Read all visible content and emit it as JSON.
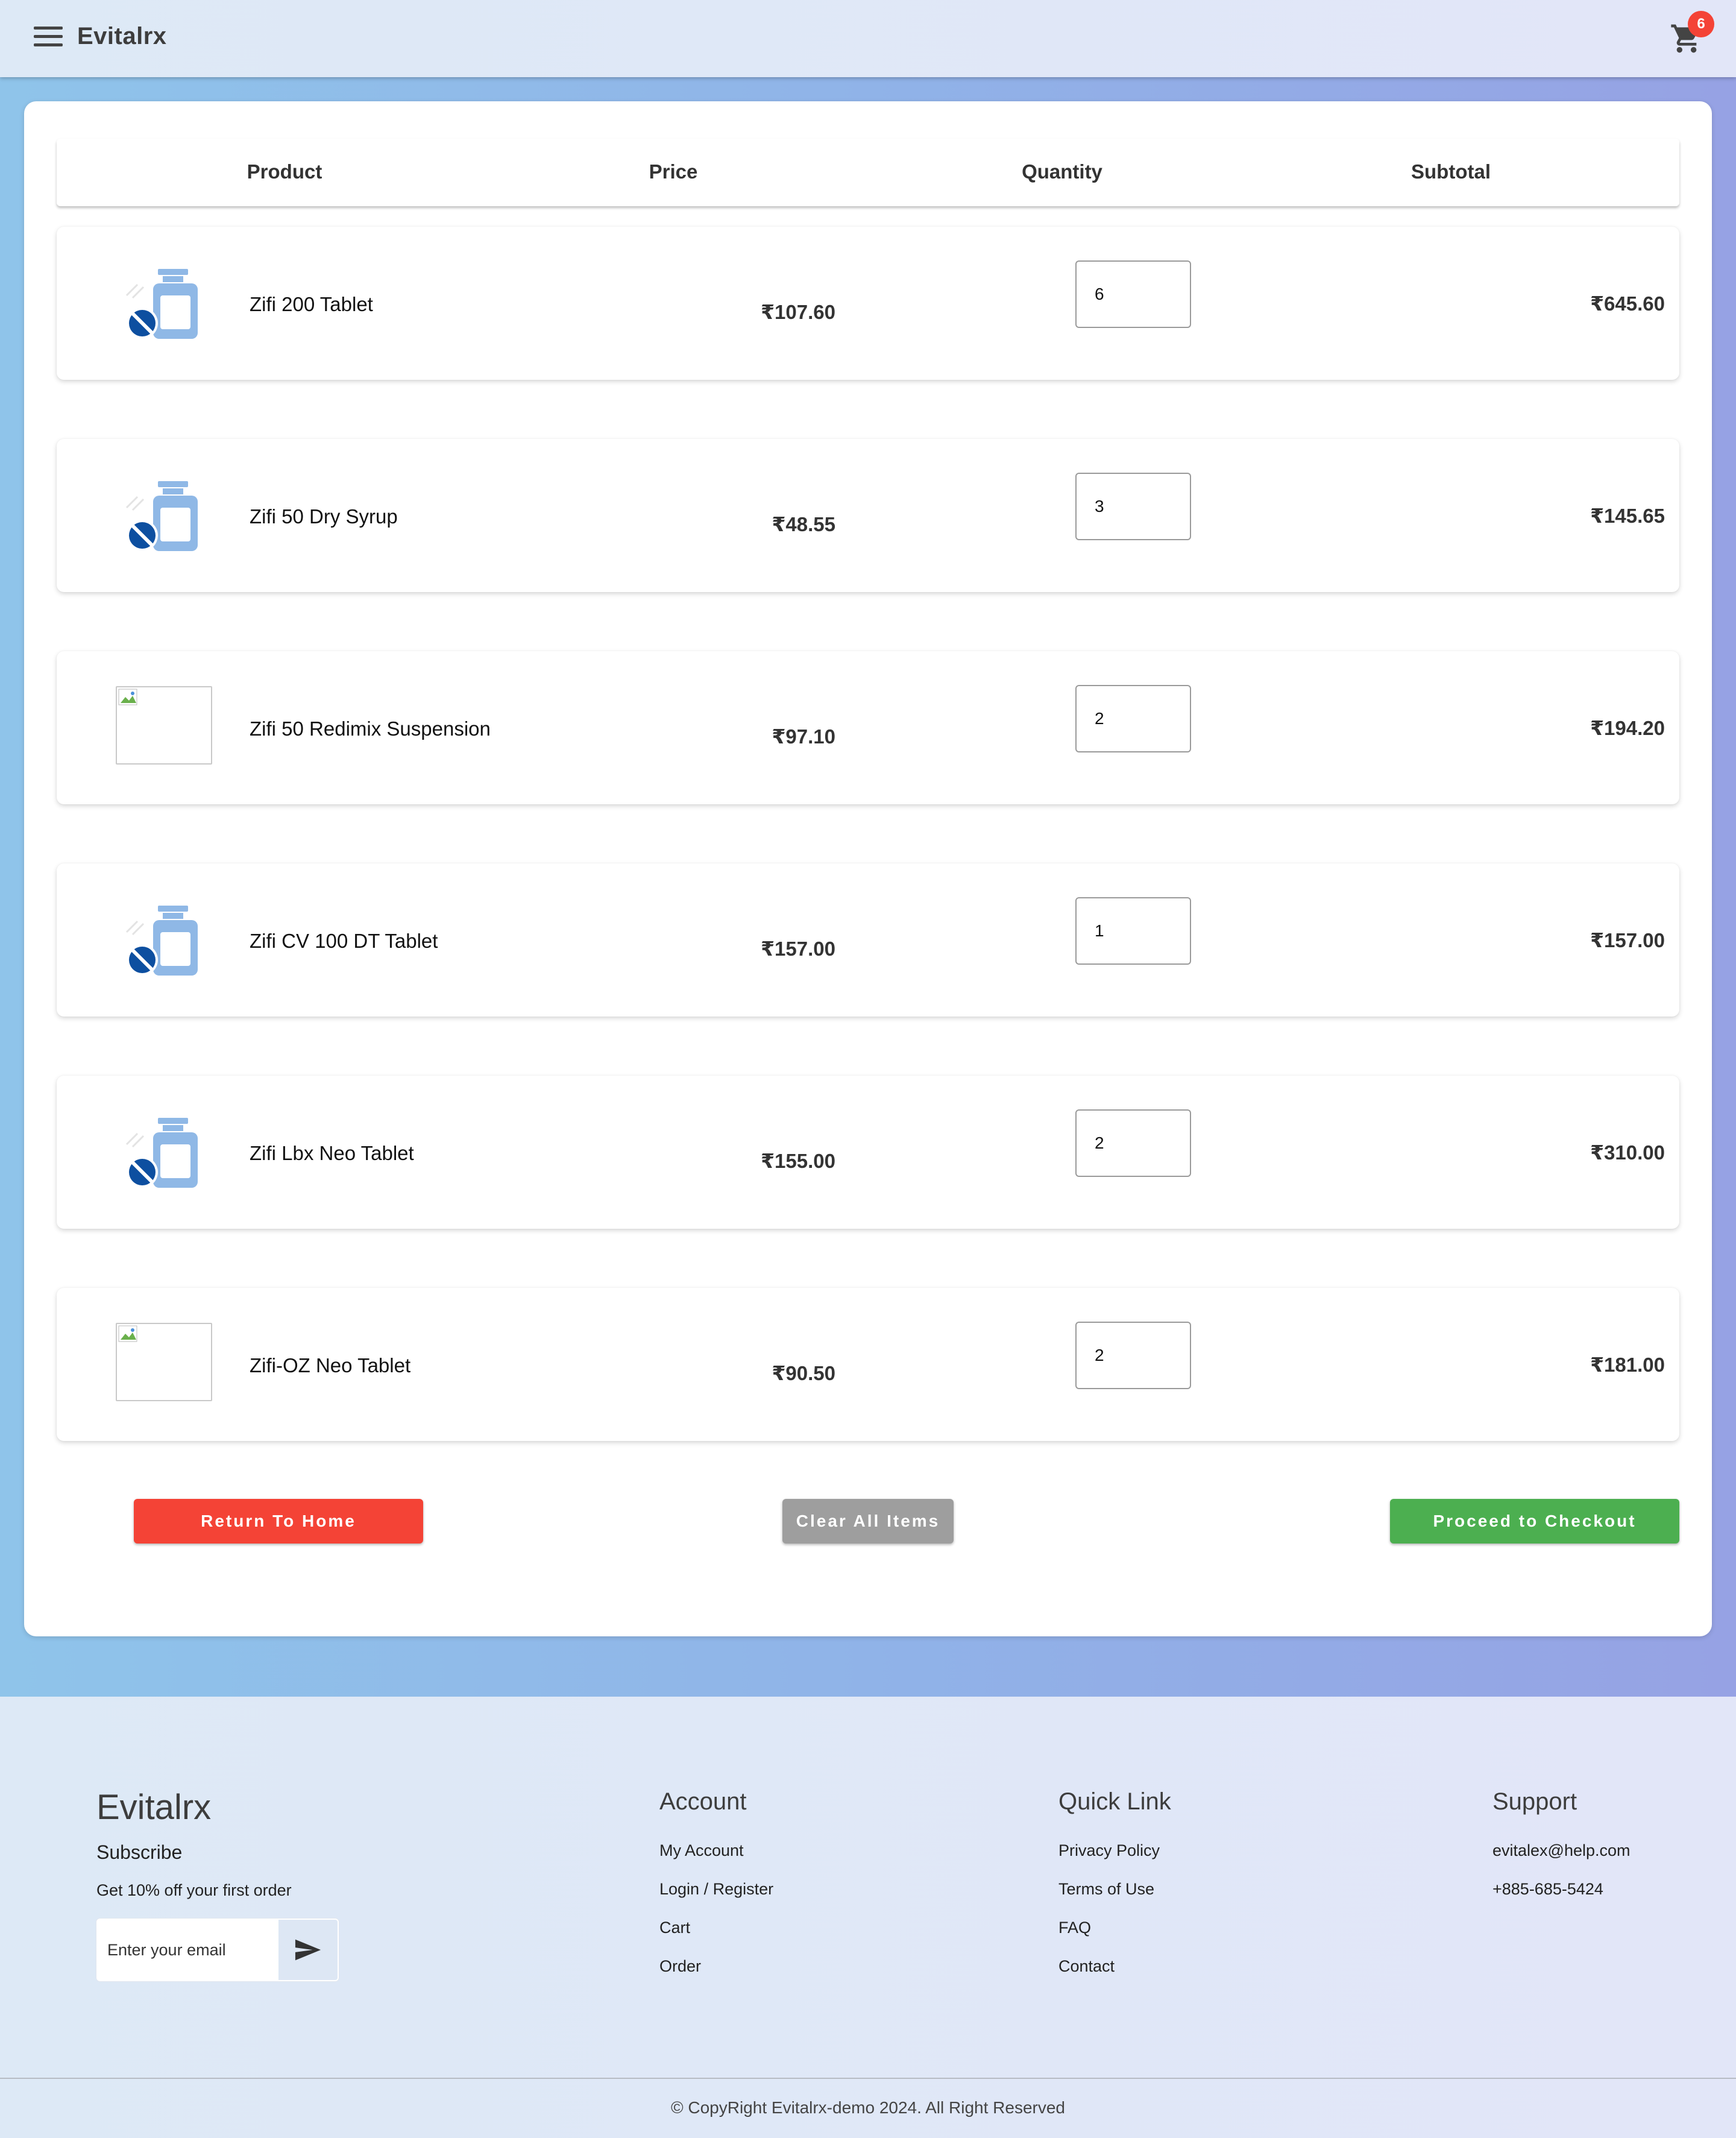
{
  "appbar": {
    "title": "Evitalrx",
    "cart_count": "6"
  },
  "table": {
    "headers": {
      "product": "Product",
      "price": "Price",
      "quantity": "Quantity",
      "subtotal": "Subtotal"
    },
    "rows": [
      {
        "name": "Zifi 200 Tablet",
        "price": "₹107.60",
        "qty": "6",
        "subtotal": "₹645.60",
        "image": "medicine-bottle-icon"
      },
      {
        "name": "Zifi 50 Dry Syrup",
        "price": "₹48.55",
        "qty": "3",
        "subtotal": "₹145.65",
        "image": "medicine-bottle-icon"
      },
      {
        "name": "Zifi 50 Redimix Suspension",
        "price": "₹97.10",
        "qty": "2",
        "subtotal": "₹194.20",
        "image": "broken-image-icon"
      },
      {
        "name": "Zifi CV 100 DT Tablet",
        "price": "₹157.00",
        "qty": "1",
        "subtotal": "₹157.00",
        "image": "medicine-bottle-icon"
      },
      {
        "name": "Zifi Lbx Neo Tablet",
        "price": "₹155.00",
        "qty": "2",
        "subtotal": "₹310.00",
        "image": "medicine-bottle-icon"
      },
      {
        "name": "Zifi-OZ Neo Tablet",
        "price": "₹90.50",
        "qty": "2",
        "subtotal": "₹181.00",
        "image": "broken-image-icon"
      }
    ]
  },
  "actions": {
    "return_home": "Return To Home",
    "clear_all": "Clear All Items",
    "checkout": "Proceed to Checkout"
  },
  "footer": {
    "brand": "Evitalrx",
    "subscribe_title": "Subscribe",
    "subscribe_offer": "Get 10% off your first order",
    "email_placeholder": "Enter your email",
    "account": {
      "title": "Account",
      "links": [
        "My Account",
        "Login / Register",
        "Cart",
        "Order"
      ]
    },
    "quick_link": {
      "title": "Quick Link",
      "links": [
        "Privacy Policy",
        "Terms of Use",
        "FAQ",
        "Contact"
      ]
    },
    "support": {
      "title": "Support",
      "email": "evitalex@help.com",
      "phone": "+885-685-5424"
    },
    "copyright": "© CopyRight Evitalrx-demo 2024. All Right Reserved"
  },
  "colors": {
    "danger": "#f44336",
    "neutral": "#9e9e9e",
    "success": "#4caf50",
    "badge": "#f44336"
  }
}
